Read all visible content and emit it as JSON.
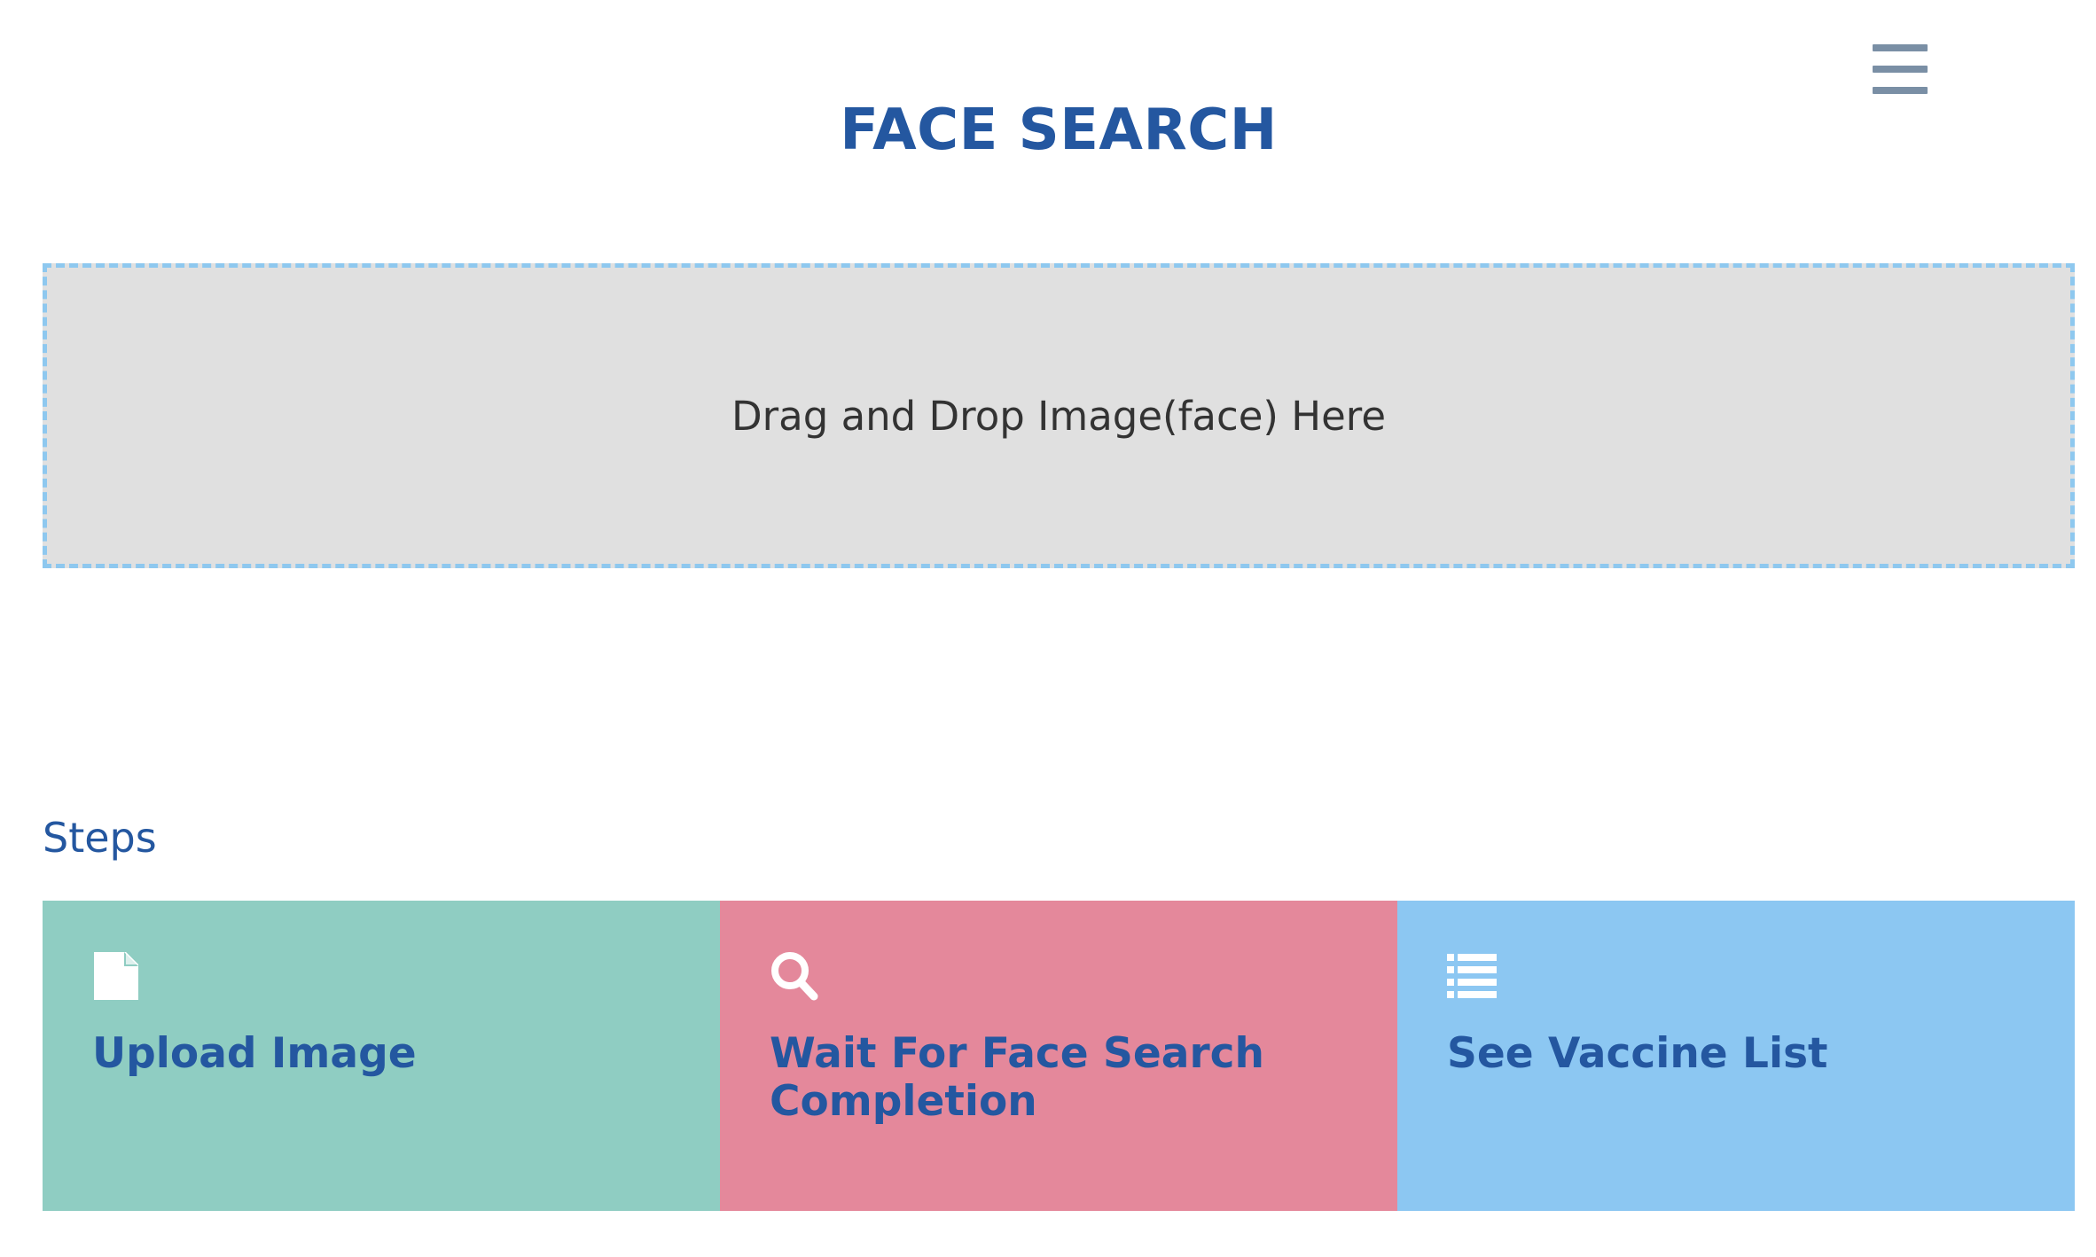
{
  "header": {
    "title": "FACE SEARCH",
    "menu_icon": "hamburger-menu-icon"
  },
  "dropzone": {
    "label": "Drag and Drop Image(face) Here"
  },
  "steps": {
    "heading": "Steps",
    "items": [
      {
        "label": "Upload Image",
        "icon": "file-icon",
        "color": "#8fcdc2"
      },
      {
        "label": "Wait For Face Search Completion",
        "icon": "search-icon",
        "color": "#e4889b"
      },
      {
        "label": "See Vaccine List",
        "icon": "list-icon",
        "color": "#8cc7f2"
      }
    ]
  },
  "colors": {
    "title": "#2457a0",
    "dropzone_border": "#8ec8ef",
    "dropzone_bg": "#e0e0e0",
    "menu_icon": "#7a8fa5"
  }
}
